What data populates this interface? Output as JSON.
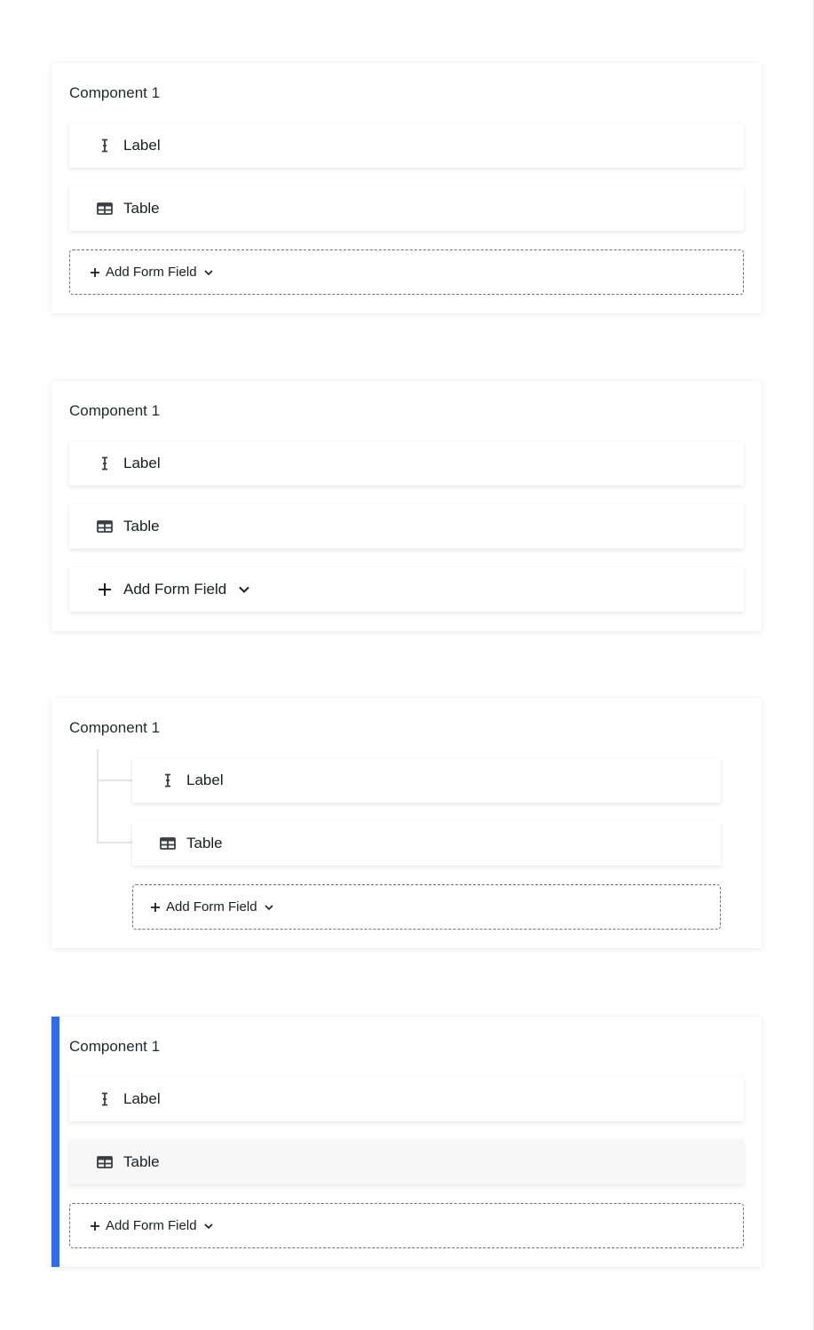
{
  "variants": [
    {
      "title": "Component 1",
      "fields": [
        {
          "label": "Label",
          "icon": "text-cursor-icon"
        },
        {
          "label": "Table",
          "icon": "table-icon"
        }
      ],
      "add_button": {
        "label": "Add Form Field",
        "style": "dashed-compact"
      }
    },
    {
      "title": "Component 1",
      "fields": [
        {
          "label": "Label",
          "icon": "text-cursor-icon"
        },
        {
          "label": "Table",
          "icon": "table-icon"
        }
      ],
      "add_button": {
        "label": "Add Form Field",
        "style": "solid-row"
      }
    },
    {
      "title": "Component 1",
      "fields": [
        {
          "label": "Label",
          "icon": "text-cursor-icon"
        },
        {
          "label": "Table",
          "icon": "table-icon"
        }
      ],
      "add_button": {
        "label": "Add Form Field",
        "style": "dashed-compact-nested"
      }
    },
    {
      "title": "Component 1",
      "fields": [
        {
          "label": "Label",
          "icon": "text-cursor-icon"
        },
        {
          "label": "Table",
          "icon": "table-icon",
          "hovered": true
        }
      ],
      "add_button": {
        "label": "Add Form Field",
        "style": "dashed-compact"
      },
      "selected": true
    }
  ],
  "colors": {
    "accent": "#2b6ef5",
    "dashed_border": "#6c6f75",
    "hover_row": "#f7f7f8",
    "tree_line": "#e3e4e6"
  }
}
